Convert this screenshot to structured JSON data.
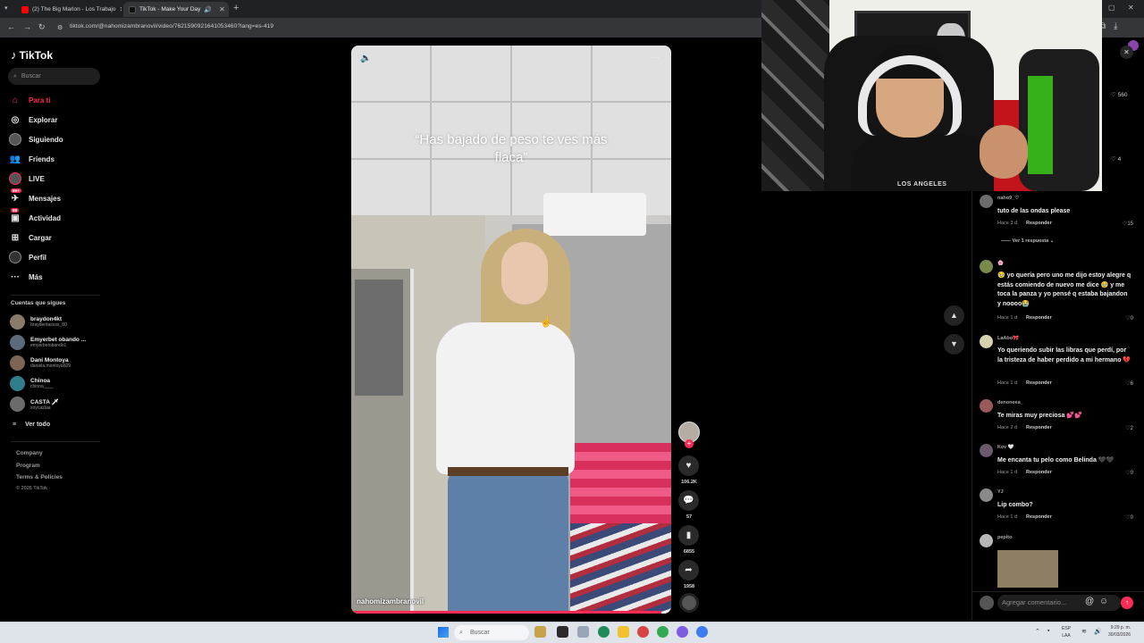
{
  "browser": {
    "tabs": [
      {
        "label": "(2) The Big Marlon - Los Trabajo",
        "active": false,
        "favicon_color": "#ff0000"
      },
      {
        "label": "TikTok - Make Your Day",
        "active": true,
        "favicon_color": "#000000"
      }
    ],
    "url": "tiktok.com/@nahomizambranovil/video/7621590921641053460?lang=es-419"
  },
  "sidebar": {
    "logo": "TikTok",
    "search_placeholder": "Buscar",
    "nav": [
      {
        "label": "Para ti",
        "icon": "home-icon",
        "active": true
      },
      {
        "label": "Explorar",
        "icon": "compass-icon"
      },
      {
        "label": "Siguiendo",
        "icon": "following-avatar-icon"
      },
      {
        "label": "Friends",
        "icon": "friends-icon"
      },
      {
        "label": "LIVE",
        "icon": "live-avatar-icon"
      },
      {
        "label": "Mensajes",
        "icon": "messages-icon",
        "badge": "99+"
      },
      {
        "label": "Actividad",
        "icon": "activity-icon",
        "badge": "99"
      },
      {
        "label": "Cargar",
        "icon": "upload-icon"
      },
      {
        "label": "Perfil",
        "icon": "profile-avatar-icon"
      },
      {
        "label": "Más",
        "icon": "more-icon"
      }
    ],
    "following_title": "Cuentas que sigues",
    "following": [
      {
        "name": "braydon4kt",
        "handle": "braydentascos_80"
      },
      {
        "name": "Emyerbet obando ...",
        "handle": "emyerbetobando1"
      },
      {
        "name": "Dani Montoya",
        "handle": "daniela.montoya609"
      },
      {
        "name": "Chinoa",
        "handle": "chinoa____"
      },
      {
        "name": "CASTA 🗡",
        "handle": "soycastaa"
      }
    ],
    "see_all": "Ver todo",
    "footer": [
      "Company",
      "Program",
      "Terms & Policies"
    ],
    "copyright": "© 2026 TikTok"
  },
  "video": {
    "caption_quote": "“Has bajado de peso te ves más flaca”",
    "author_handle": "nahomizambranovil",
    "progress": 0.97
  },
  "actions": {
    "likes": "106.2K",
    "comments": "57",
    "saves": "6855",
    "shares": "1958"
  },
  "side_counts": [
    "560",
    "4"
  ],
  "comments": [
    {
      "user": "naho9_♡",
      "text": "tuto de las ondas please",
      "time": "Hace 3 d",
      "reply": "Responder",
      "likes": "15"
    },
    {
      "user": "🌸",
      "text": "🥹 yo quería pero uno me dijo estoy alegre q estás comiendo de nuevo me dice 🥹 y me toca la panza y yo pensé q estaba bajandon y noooo😭",
      "time": "Hace 1 d",
      "reply": "Responder",
      "likes": "0"
    },
    {
      "user": "LaAbo🎀",
      "text": "Yo queriendo subir las libras que perdí, por la tristeza de haber perdido a mi hermano 💔",
      "time": "Hace 1 d",
      "reply": "Responder",
      "likes": "6"
    },
    {
      "user": "denoneea_",
      "text": "Te miras muy preciosa 💕💕",
      "time": "Hace 2 d",
      "reply": "Responder",
      "likes": "2"
    },
    {
      "user": "Kev 🤍",
      "text": "Me encanta tu pelo como Belinda 🖤🖤",
      "time": "Hace 1 d",
      "reply": "Responder",
      "likes": "0"
    },
    {
      "user": "YJ",
      "text": "Lip combo?",
      "time": "Hace 1 d",
      "reply": "Responder",
      "likes": "0"
    },
    {
      "user": "pepito",
      "text": "",
      "time": "",
      "reply": "",
      "likes": ""
    }
  ],
  "replies_toggle": "Ver 1 respuesta",
  "comment_input_placeholder": "Agregar comentario...",
  "webcam": {
    "shirt_text": "LOS ANGELES"
  },
  "taskbar": {
    "search_placeholder": "Buscar",
    "lang": "ESP\nLAA",
    "time": "9:29 p. m.",
    "date": "30/03/2026"
  }
}
